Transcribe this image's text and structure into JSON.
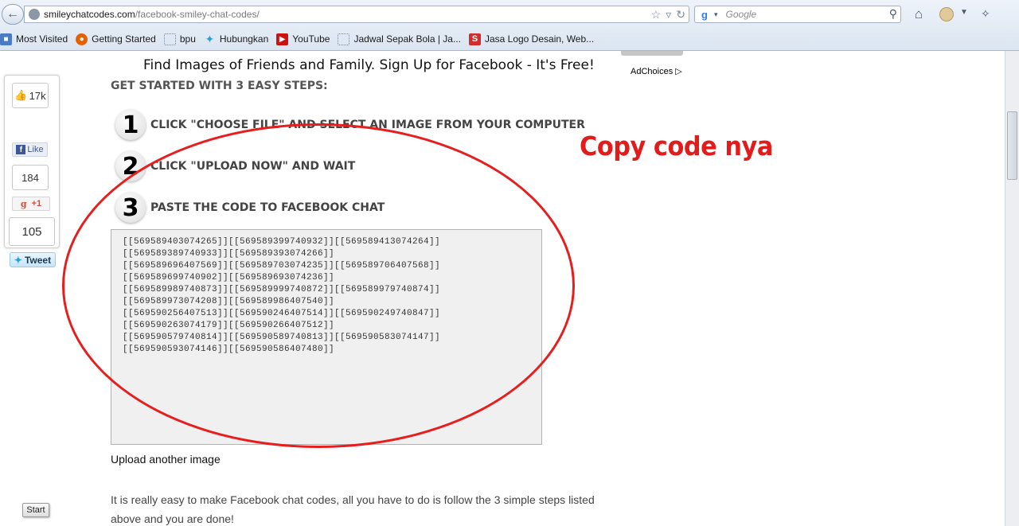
{
  "browser": {
    "url_host": "smileychatcodes.com",
    "url_path": "/facebook-smiley-chat-codes/",
    "search_placeholder": "Google",
    "bookmarks": [
      {
        "label": "Most Visited",
        "icon": "most-visited-icon",
        "color": "#4a7bc4"
      },
      {
        "label": "Getting Started",
        "icon": "firefox-icon",
        "color": "#e66000"
      },
      {
        "label": "bpu",
        "icon": "dotted-page-icon",
        "color": "#9aa6b5"
      },
      {
        "label": "Hubungkan",
        "icon": "twitter-bird-icon",
        "color": "#2a9fd6"
      },
      {
        "label": "YouTube",
        "icon": "youtube-icon",
        "color": "#cc1111"
      },
      {
        "label": "Jadwal Sepak Bola | Ja...",
        "icon": "dotted-page-icon",
        "color": "#9aa6b5"
      },
      {
        "label": "Jasa Logo Desain, Web...",
        "icon": "s-logo-icon",
        "color": "#d42b2b"
      }
    ]
  },
  "page": {
    "ad_banner": "Find Images of Friends and Family. Sign Up for Facebook - It's Free!",
    "adchoices": "AdChoices",
    "steps_heading": "GET STARTED WITH 3 EASY STEPS:",
    "steps": [
      {
        "num": "1",
        "text": "CLICK \"CHOOSE FILE\" AND SELECT AN IMAGE FROM YOUR COMPUTER"
      },
      {
        "num": "2",
        "text": "CLICK \"UPLOAD NOW\" AND WAIT"
      },
      {
        "num": "3",
        "text": "PASTE THE CODE TO FACEBOOK CHAT"
      }
    ],
    "code_lines": [
      "[[569589403074265]][[569589399740932]][[569589413074264]]",
      "[[569589389740933]][[569589393074266]]",
      "[[569589696407569]][[569589703074235]][[569589706407568]]",
      "[[569589699740902]][[569589693074236]]",
      "[[569589989740873]][[569589999740872]][[569589979740874]]",
      "[[569589973074208]][[569589986407540]]",
      "[[569590256407513]][[569590246407514]][[569590249740847]]",
      "[[569590263074179]][[569590266407512]]",
      "[[569590579740814]][[569590589740813]][[569590583074147]]",
      "[[569590593074146]][[569590586407480]]"
    ],
    "upload_another": "Upload another image",
    "info_text": "It is really easy to make Facebook chat codes, all you have to do is follow the 3 simple steps listed above and you are done!",
    "annotation": "Copy code nya",
    "annotation_color": "#e41b1b"
  },
  "share": {
    "fb_count": "17k",
    "fb_like_label": "Like",
    "gplus_count": "184",
    "gplus_label": "+1",
    "tweet_count": "105",
    "tweet_label": "Tweet"
  },
  "start_label": "Start"
}
